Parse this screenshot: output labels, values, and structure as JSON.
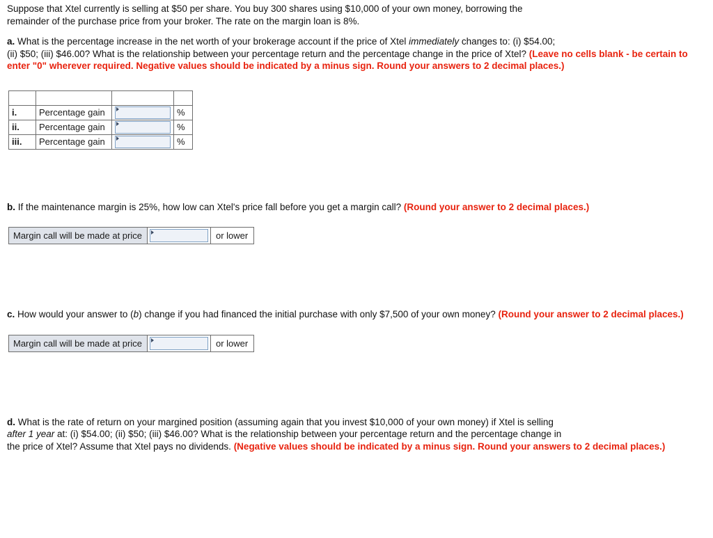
{
  "intro": {
    "line1_a": "Suppose that Xtel currently is selling at $50 per share. You buy 300 shares using $10,000 of your own money, borrowing the",
    "line1_b": "remainder of the purchase price from your broker. The rate on the margin loan is 8%."
  },
  "part_a": {
    "label": "a.",
    "text_1": "What is the percentage increase in the net worth of your brokerage account if the price of Xtel ",
    "italic_1": "immediately",
    "text_2": " changes to: (i) $54.00;",
    "text_3": "(ii) $50; (iii) $46.00? What is the relationship between your percentage return and the percentage change in the price of Xtel? ",
    "instruction": "(Leave no cells blank - be certain to enter \"0\" wherever required. Negative values should be indicated by a minus sign. Round your answers to 2 decimal places.)",
    "table": {
      "rows": [
        {
          "num": "i.",
          "label": "Percentage gain",
          "value": "",
          "unit": "%"
        },
        {
          "num": "ii.",
          "label": "Percentage gain",
          "value": "",
          "unit": "%"
        },
        {
          "num": "iii.",
          "label": "Percentage gain",
          "value": "",
          "unit": "%"
        }
      ]
    }
  },
  "part_b": {
    "label": "b.",
    "text_1": "If the maintenance margin is 25%, how low can Xtel's price fall before you get a margin call? ",
    "instruction": "(Round your answer to 2 decimal places.)",
    "answer_label": "Margin call will be made at price",
    "answer_value": "",
    "answer_suffix": "or lower"
  },
  "part_c": {
    "label": "c.",
    "text_1": "How would your answer to (",
    "italic_1": "b",
    "text_2": ") change if you had financed the initial purchase with only $7,500 of your own money? ",
    "instruction": "(Round your answer to 2 decimal places.)",
    "answer_label": "Margin call will be made at price",
    "answer_value": "",
    "answer_suffix": "or lower"
  },
  "part_d": {
    "label": "d.",
    "text_1": "What is the rate of return on your margined position (assuming again that you invest $10,000 of your own money) if Xtel is selling",
    "italic_1": "after 1 year",
    "text_2": " at: (i) $54.00; (ii) $50; (iii) $46.00? What is the relationship between your percentage return and the percentage change in",
    "text_3": "the price of Xtel? Assume that Xtel pays no dividends. ",
    "instruction": "(Negative values should be indicated by a minus sign. Round your answers to 2 decimal places.)"
  },
  "colors": {
    "instruction_red": "#e8230f",
    "header_fill": "#dfe3ea",
    "input_fill": "#eef2f8",
    "input_border": "#7ea0c4",
    "table_border": "#6d6d6d"
  }
}
